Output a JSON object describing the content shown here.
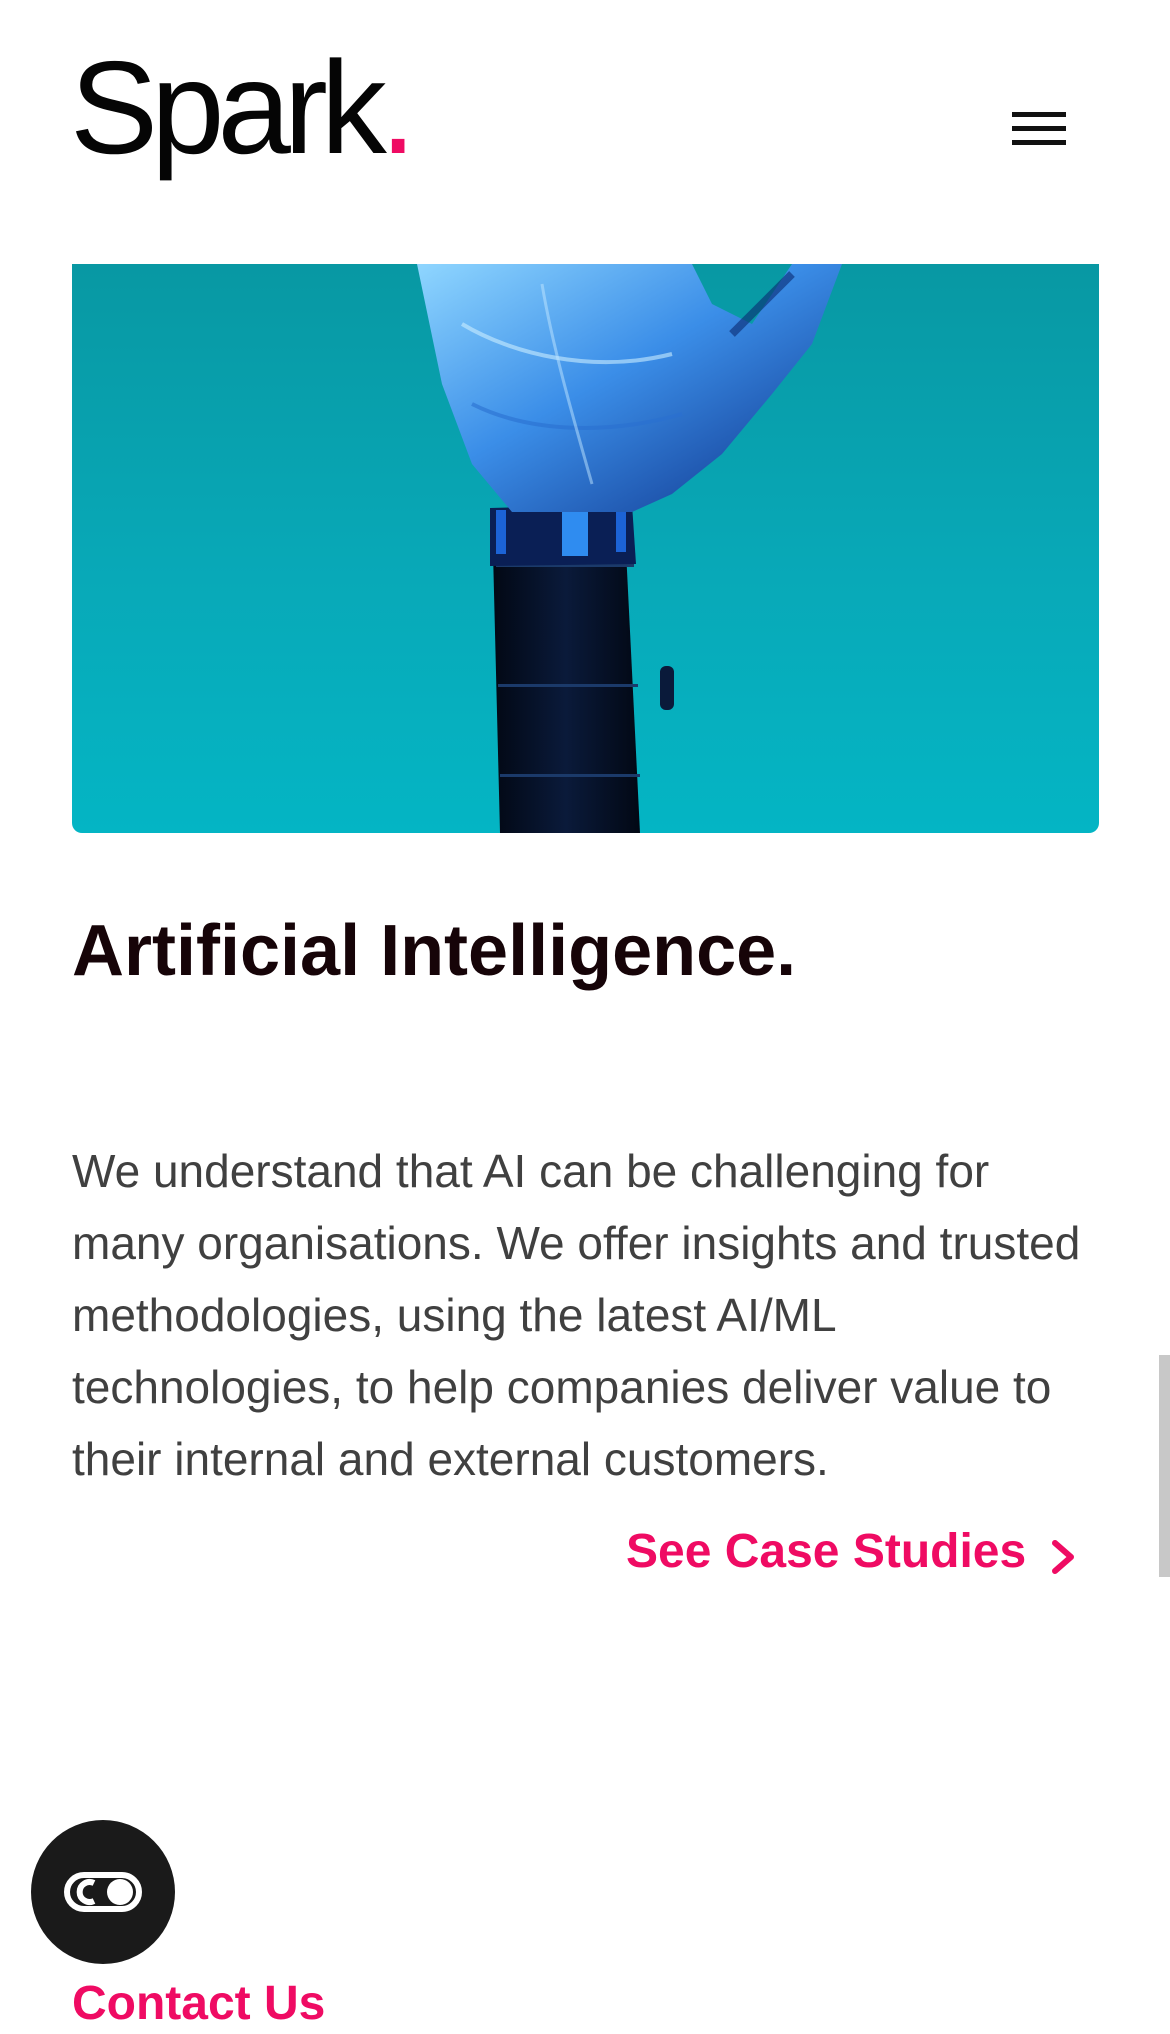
{
  "header": {
    "logo_text": "Spark",
    "logo_dot": ".",
    "menu_icon": "hamburger-menu-icon"
  },
  "hero": {
    "image_subject": "robotic hand against teal background",
    "background_color": "#08a9b8"
  },
  "section": {
    "title": "Artificial Intelligence.",
    "body": "We understand that AI can be challenging for many organisations. We offer insights and trusted methodologies, using the latest AI/ML technologies, to help companies deliver value to their internal and external customers.",
    "cta_label": "See Case Studies",
    "cta_icon": "chevron-right-icon"
  },
  "floating": {
    "accessibility_icon": "accessibility-toggle-icon"
  },
  "footer_peek": {
    "contact_label": "Contact Us"
  },
  "colors": {
    "accent": "#ef0b63",
    "title": "#160408",
    "body_text": "#404040"
  }
}
